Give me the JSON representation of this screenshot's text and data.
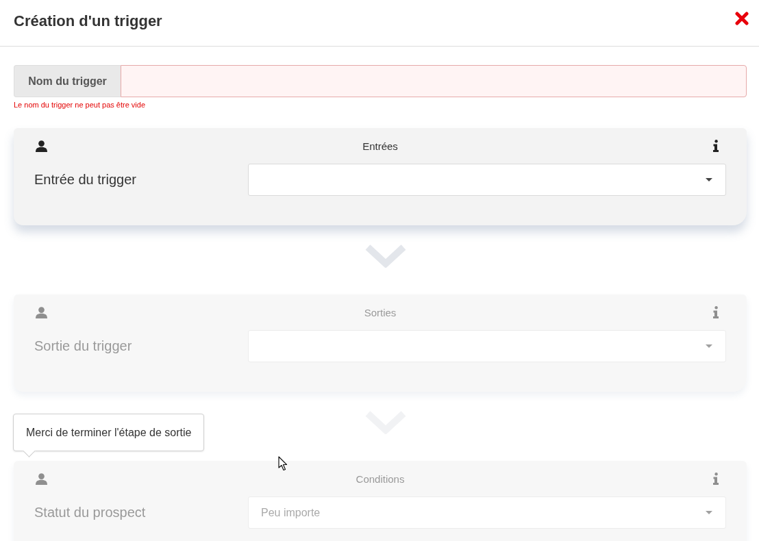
{
  "dialog": {
    "title": "Création d'un trigger"
  },
  "name_field": {
    "label": "Nom du trigger",
    "invalid": true,
    "error": "Le nom du trigger ne peut pas être vide"
  },
  "steps": [
    {
      "title": "Entrées",
      "active": true,
      "fields": [
        {
          "label": "Entrée du trigger"
        }
      ]
    },
    {
      "title": "Sorties",
      "active": false,
      "fields": [
        {
          "label": "Sortie du trigger"
        }
      ]
    },
    {
      "title": "Conditions",
      "active": false,
      "tooltip": "Merci de terminer l'étape de sortie",
      "fields": [
        {
          "label": "Statut du prospect",
          "value": "Peu importe"
        }
      ]
    }
  ]
}
